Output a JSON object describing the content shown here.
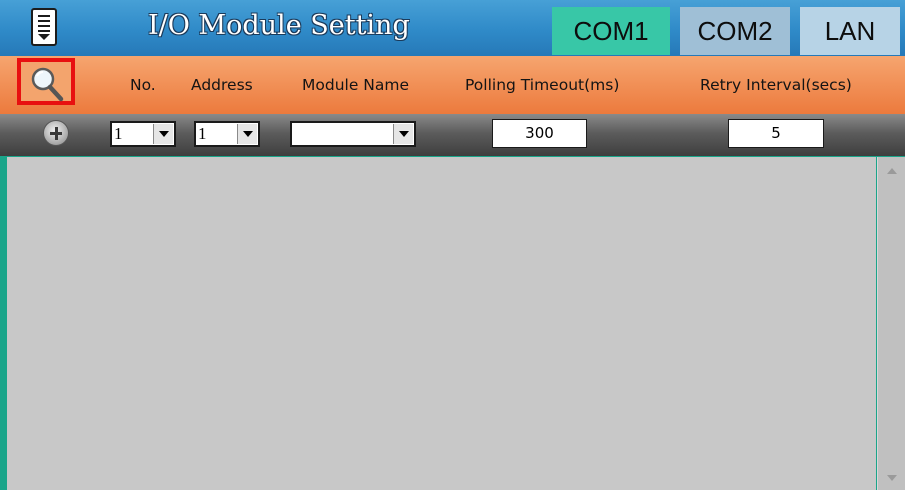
{
  "header": {
    "title": "I/O Module Setting",
    "tabs": [
      {
        "label": "COM1",
        "active": true
      },
      {
        "label": "COM2",
        "active": false
      },
      {
        "label": "LAN",
        "active": false
      }
    ]
  },
  "columns": {
    "no": "No.",
    "address": "Address",
    "module_name": "Module Name",
    "polling_timeout": "Polling Timeout(ms)",
    "retry_interval": "Retry Interval(secs)"
  },
  "inputs": {
    "no_value": "1",
    "address_value": "1",
    "module_name_value": "",
    "polling_timeout_value": "300",
    "retry_interval_value": "5"
  },
  "icons": {
    "menu": "document-menu-icon",
    "search": "magnifier-icon",
    "add": "plus-circle-icon"
  },
  "colors": {
    "title_bar": "#2f8ac8",
    "active_tab": "#38c7a7",
    "header_bar": "#ec7a3d",
    "highlight": "#e81010"
  }
}
